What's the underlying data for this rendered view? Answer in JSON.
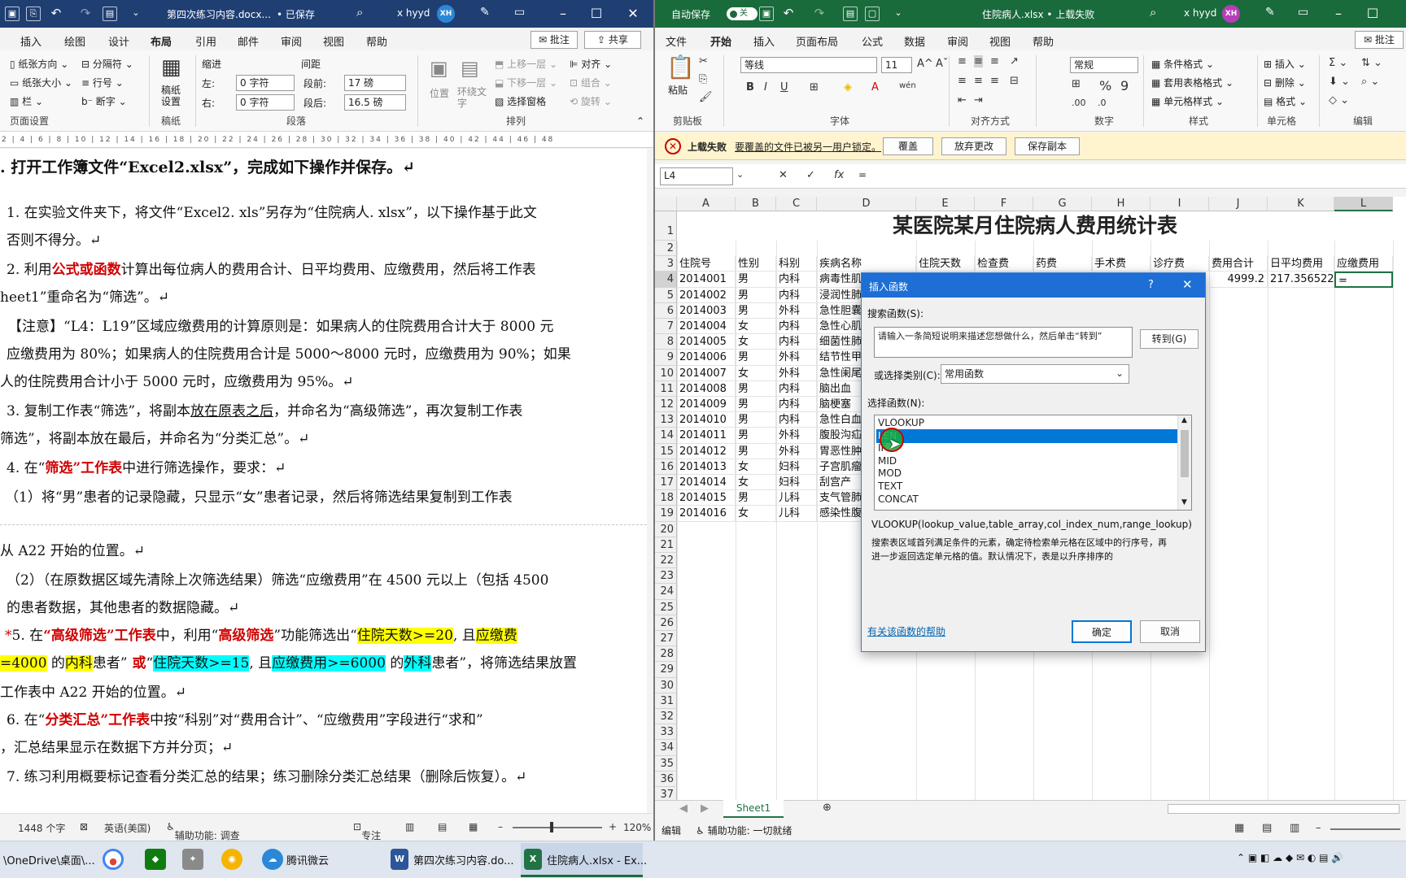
{
  "word": {
    "title": "第四次练习内容.docx...",
    "saved": "• 已保存",
    "user": "x hyyd",
    "initials": "XH",
    "tabs": [
      "插入",
      "绘图",
      "设计",
      "布局",
      "引用",
      "邮件",
      "审阅",
      "视图",
      "帮助"
    ],
    "comment_btn": "批注",
    "share_btn": "共享",
    "ribbon": {
      "paper_dir": "纸张方向",
      "paper_size": "纸张大小",
      "columns": "栏",
      "breaks": "分隔符",
      "line_numbers": "行号",
      "hyphenation": "断字",
      "manuscript": "稿纸设置",
      "indent_label": "缩进",
      "spacing_label": "间距",
      "left_label": "左:",
      "right_label": "右:",
      "left_val": "0 字符",
      "right_val": "0 字符",
      "before_label": "段前:",
      "after_label": "段后:",
      "before_val": "17 磅",
      "after_val": "16.5 磅",
      "position": "位置",
      "wrap": "环绕文字",
      "bring_forward": "上移一层",
      "send_backward": "下移一层",
      "selection_pane": "选择窗格",
      "align": "对齐",
      "group": "组合",
      "rotate": "旋转",
      "grp_page_setup": "页面设置",
      "grp_manuscript": "稿纸",
      "grp_paragraph": "段落",
      "grp_arrange": "排列"
    },
    "ruler": "2 | 4 | 6 | 8 | 10 | 12 | 14 | 16 | 18 | 20 | 22 | 24 | 26 | 28 | 30 | 32 | 34 | 36 | 38 | 40 | 42 | 44 | 46 | 48",
    "doc": {
      "heading": ". 打开工作簿文件“Excel2.xlsx”，完成如下操作并保存。↵",
      "l1a": "1. 在实验文件夹下，将文件“Excel2. xls”另存为“住院病人. xlsx”，以下操作基于此文",
      "l1b": "否则不得分。↵",
      "l2a_1": "2. 利用",
      "l2a_red": "公式或函数",
      "l2a_2": "计算出每位病人的费用合计、日平均费用、应缴费用，然后将工作表",
      "l2b": "heet1”重命名为“筛选”。↵",
      "n1": "【注意】“L4：L19”区域应缴费用的计算原则是：如果病人的住院费用合计大于 8000 元",
      "n2": "应缴费用为 80%；如果病人的住院费用合计是 5000～8000 元时，应缴费用为 90%；如果",
      "n3": "人的住院费用合计小于 5000 元时，应缴费用为 95%。↵",
      "l3a_1": "3. 复制工作表“筛选”，将副本",
      "l3a_ul": "放在原表之后",
      "l3a_2": "，并命名为“高级筛选”，再次复制工作表",
      "l3b": "筛选”，将副本放在最后，并命名为“分类汇总”。↵",
      "l4_1": "4. 在“",
      "l4_red": "筛选”工作表",
      "l4_2": "中进行筛选操作，要求：↵",
      "l4s1": "（1）将“男”患者的记录隐藏，只显示“女”患者记录，然后将筛选结果复制到工作表",
      "l4s1b": "从 A22 开始的位置。↵",
      "l4s2a": "（2）（在原数据区域先清除上次筛选结果）筛选“应缴费用”在 4500 元以上（包括 4500",
      "l4s2b": "的患者数据，其他患者的数据隐藏。↵",
      "l5_star": "*",
      "l5_1": "5. 在",
      "l5_red1": "“高级筛选”工作表",
      "l5_2": "中，利用“",
      "l5_red2": "高级筛选",
      "l5_3": "”功能筛选出“",
      "l5_y1": "住院天数>=20",
      "l5_4": ", 且",
      "l5_y2": "应缴费",
      "l5b_y3": "=4000",
      "l5b_1": " 的",
      "l5b_y4": "内科",
      "l5b_2": "患者”",
      "l5b_red": " 或",
      "l5b_3": "“",
      "l5b_c1": "住院天数>=15",
      "l5b_4": ", 且",
      "l5b_c2": "应缴费用>=6000",
      "l5b_5": " 的",
      "l5b_c3": "外科",
      "l5b_6": "患者”，将筛选结果放置",
      "l5c": "工作表中 A22 开始的位置。↵",
      "l6_1": "6. 在“",
      "l6_red": "分类汇总”工作表",
      "l6_2": "中按“科别”对“费用合计”、“应缴费用”字段进行“求和”",
      "l6b": "，汇总结果显示在数据下方并分页；↵",
      "l7": "7. 练习利用概要标记查看分类汇总的结果；练习删除分类汇总结果（删除后恢复）。↵"
    },
    "status": {
      "words": "1448 个字",
      "lang": "英语(美国)",
      "access": "辅助功能: 调查",
      "focus": "专注",
      "zoom": "120%"
    }
  },
  "excel": {
    "autosave": "自动保存",
    "toggle": "关",
    "title": "住院病人.xlsx • 上载失败",
    "user": "x hyyd",
    "initials": "XH",
    "tabs": [
      "文件",
      "开始",
      "插入",
      "页面布局",
      "公式",
      "数据",
      "审阅",
      "视图",
      "帮助"
    ],
    "comment_btn": "批注",
    "ribbon": {
      "paste": "粘贴",
      "font_name": "等线",
      "font_size": "11",
      "number_format": "常规",
      "cond_format": "条件格式",
      "table_format": "套用表格格式",
      "cell_styles": "单元格样式",
      "insert": "插入",
      "delete": "删除",
      "format": "格式",
      "grp_clipboard": "剪贴板",
      "grp_font": "字体",
      "grp_align": "对齐方式",
      "grp_number": "数字",
      "grp_styles": "样式",
      "grp_cells": "单元格",
      "grp_edit": "编辑"
    },
    "notif": {
      "title": "上载失败",
      "msg": "要覆盖的文件已被另一用户锁定。",
      "b1": "覆盖",
      "b2": "放弃更改",
      "b3": "保存副本"
    },
    "namebox": "L4",
    "formula": "=",
    "columns": [
      "A",
      "B",
      "C",
      "D",
      "E",
      "F",
      "G",
      "H",
      "I",
      "J",
      "K",
      "L"
    ],
    "sheet_title": "某医院某月住院病人费用统计表",
    "headers": [
      "住院号",
      "性别",
      "科别",
      "疾病名称",
      "住院天数",
      "检查费",
      "药费",
      "手术费",
      "诊疗费",
      "费用合计",
      "日平均费用",
      "应缴费用"
    ],
    "records": [
      [
        "2014001",
        "男",
        "内科",
        "病毒性肌",
        "",
        "",
        "",
        "",
        "",
        "4999.2",
        "217.356522",
        "="
      ],
      [
        "2014002",
        "男",
        "内科",
        "浸润性肺",
        "",
        "",
        "",
        "",
        "",
        "",
        "",
        ""
      ],
      [
        "2014003",
        "男",
        "外科",
        "急性胆囊",
        "",
        "",
        "",
        "",
        "",
        "",
        "",
        ""
      ],
      [
        "2014004",
        "女",
        "内科",
        "急性心肌",
        "",
        "",
        "",
        "",
        "",
        "",
        "",
        ""
      ],
      [
        "2014005",
        "女",
        "内科",
        "细菌性肺",
        "",
        "",
        "",
        "",
        "",
        "",
        "",
        ""
      ],
      [
        "2014006",
        "男",
        "外科",
        "结节性甲",
        "",
        "",
        "",
        "",
        "",
        "",
        "",
        ""
      ],
      [
        "2014007",
        "女",
        "外科",
        "急性阑尾",
        "",
        "",
        "",
        "",
        "",
        "",
        "",
        ""
      ],
      [
        "2014008",
        "男",
        "内科",
        "脑出血",
        "",
        "",
        "",
        "",
        "",
        "",
        "",
        ""
      ],
      [
        "2014009",
        "男",
        "内科",
        "脑梗塞",
        "",
        "",
        "",
        "",
        "",
        "",
        "",
        ""
      ],
      [
        "2014010",
        "男",
        "内科",
        "急性白血",
        "",
        "",
        "",
        "",
        "",
        "",
        "",
        ""
      ],
      [
        "2014011",
        "男",
        "外科",
        "腹股沟疝",
        "",
        "",
        "",
        "",
        "",
        "",
        "",
        ""
      ],
      [
        "2014012",
        "男",
        "外科",
        "胃恶性肿",
        "",
        "",
        "",
        "",
        "",
        "",
        "",
        ""
      ],
      [
        "2014013",
        "女",
        "妇科",
        "子宫肌瘤",
        "",
        "",
        "",
        "",
        "",
        "",
        "",
        ""
      ],
      [
        "2014014",
        "女",
        "妇科",
        "刮宫产",
        "",
        "",
        "",
        "",
        "",
        "",
        "",
        ""
      ],
      [
        "2014015",
        "男",
        "儿科",
        "支气管肺",
        "",
        "",
        "",
        "",
        "",
        "",
        "",
        ""
      ],
      [
        "2014016",
        "女",
        "儿科",
        "感染性腹",
        "",
        "",
        "",
        "",
        "",
        "",
        "",
        ""
      ]
    ],
    "sheet_tab": "Sheet1",
    "status_mode": "编辑",
    "status_access": "辅助功能: 一切就绪"
  },
  "dialog": {
    "title": "插入函数",
    "help": "?",
    "search_label": "搜索函数(S):",
    "search_text": "请输入一条简短说明来描述您想做什么，然后单击“转到”",
    "go_btn": "转到(G)",
    "category_label": "或选择类别(C):",
    "category_value": "常用函数",
    "select_label": "选择函数(N):",
    "functions": [
      "VLOOKUP",
      "LEN",
      "IF",
      "MID",
      "MOD",
      "TEXT",
      "CONCAT"
    ],
    "selected_index": 1,
    "signature": "VLOOKUP(lookup_value,table_array,col_index_num,range_lookup)",
    "desc1": "搜索表区域首列满足条件的元素，确定待检索单元格在区域中的行序号，再",
    "desc2": "进一步返回选定单元格的值。默认情况下，表是以升序排序的",
    "help_link": "有关该函数的帮助",
    "ok": "确定",
    "cancel": "取消"
  },
  "taskbar": {
    "onedrive": "\\OneDrive\\桌面\\...",
    "tencent": "腾讯微云",
    "word_task": "第四次练习内容.do...",
    "excel_task": "住院病人.xlsx - Ex..."
  },
  "colors": {
    "word_blue": "#1f3f73",
    "excel_green": "#1a6b3c",
    "dialog_blue": "#1d6fd6",
    "selection": "#0078d7"
  }
}
